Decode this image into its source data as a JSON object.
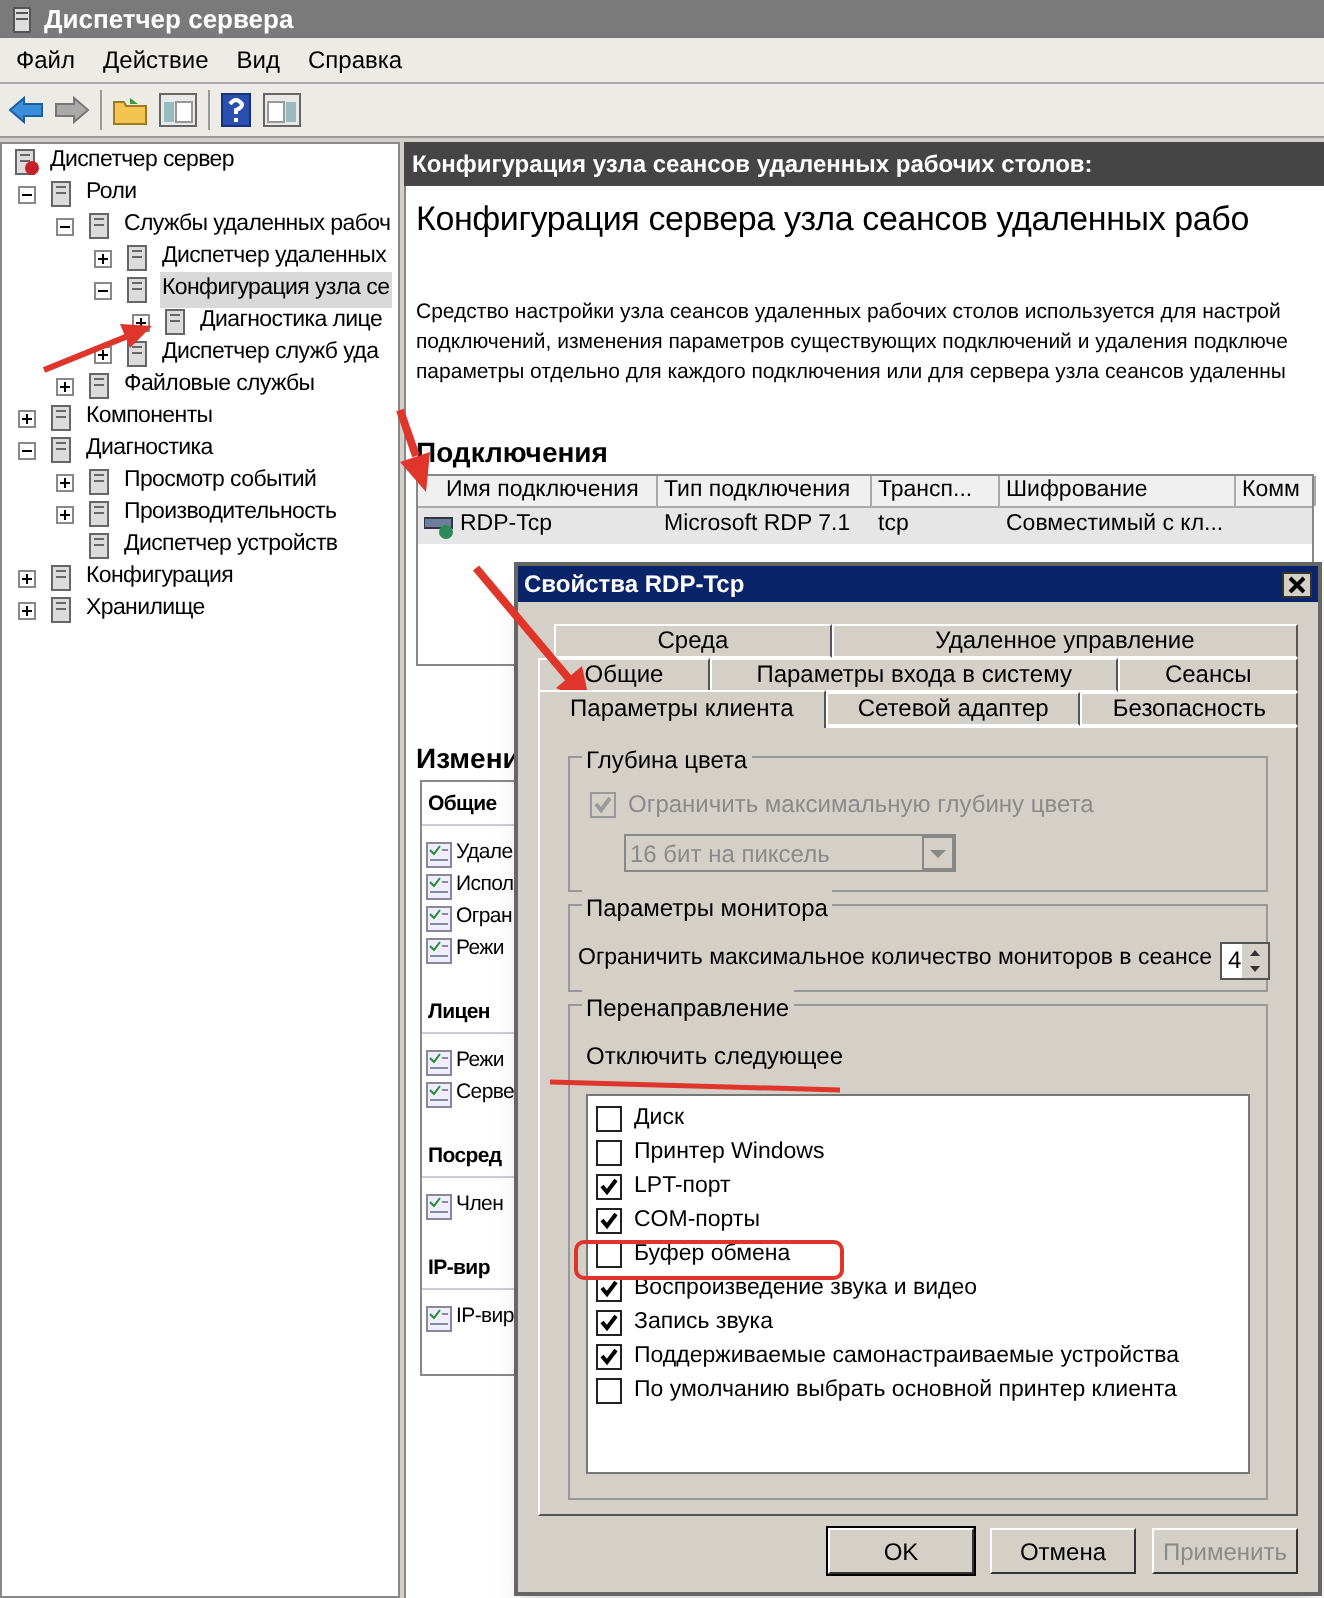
{
  "window": {
    "title": "Диспетчер сервера"
  },
  "menu": [
    "Файл",
    "Действие",
    "Вид",
    "Справка"
  ],
  "tree": [
    {
      "label": "Диспетчер сервер",
      "kind": "root",
      "selected": false,
      "children": [
        {
          "label": "Роли",
          "kind": "node",
          "expanded": true,
          "selected": false,
          "children": [
            {
              "label": "Службы удаленных рабоч",
              "kind": "node",
              "expanded": true,
              "selected": false,
              "children": [
                {
                  "label": "Диспетчер удаленных",
                  "kind": "node",
                  "expanded": false,
                  "selected": false
                },
                {
                  "label": "Конфигурация узла се",
                  "kind": "node",
                  "expanded": true,
                  "selected": true,
                  "children": [
                    {
                      "label": "Диагностика лице",
                      "kind": "node",
                      "expanded": false,
                      "selected": false
                    }
                  ]
                },
                {
                  "label": "Диспетчер служб уда",
                  "kind": "node",
                  "expanded": false,
                  "selected": false
                }
              ]
            },
            {
              "label": "Файловые службы",
              "kind": "node",
              "expanded": false,
              "selected": false
            }
          ]
        },
        {
          "label": "Компоненты",
          "kind": "node",
          "expanded": false,
          "selected": false
        },
        {
          "label": "Диагностика",
          "kind": "node",
          "expanded": true,
          "selected": false,
          "children": [
            {
              "label": "Просмотр событий",
              "kind": "node",
              "expanded": false,
              "selected": false
            },
            {
              "label": "Производительность",
              "kind": "node",
              "expanded": false,
              "selected": false
            },
            {
              "label": "Диспетчер устройств",
              "kind": "leaf",
              "selected": false
            }
          ]
        },
        {
          "label": "Конфигурация",
          "kind": "node",
          "expanded": false,
          "selected": false
        },
        {
          "label": "Хранилище",
          "kind": "node",
          "expanded": false,
          "selected": false
        }
      ]
    }
  ],
  "panel": {
    "header": "Конфигурация узла сеансов удаленных рабочих столов:",
    "title": "Конфигурация сервера узла сеансов удаленных рабо",
    "description": [
      "Средство настройки узла сеансов удаленных рабочих столов используется для настрой",
      "подключений, изменения параметров существующих подключений и удаления подключе",
      "параметры отдельно для каждого подключения или для сервера узла сеансов удаленны"
    ],
    "connections": {
      "heading": "Подключения",
      "columns": [
        "Имя подключения",
        "Тип подключения",
        "Трансп...",
        "Шифрование",
        "Комм"
      ],
      "rows": [
        [
          "RDP-Tcp",
          "Microsoft RDP 7.1",
          "tcp",
          "Совместимый с кл..."
        ]
      ]
    },
    "changes": {
      "heading": "Измени",
      "groups": [
        {
          "heading": "Общие",
          "items": [
            "Удале",
            "Испол",
            "Огран",
            "Режи"
          ]
        },
        {
          "heading": "Лицен",
          "items": [
            "Режи",
            "Серве"
          ]
        },
        {
          "heading": "Посред",
          "items": [
            "Член"
          ]
        },
        {
          "heading": "IP-вир",
          "items": [
            "IP-вир"
          ]
        }
      ]
    }
  },
  "dialog": {
    "title": "Свойства RDP-Tcp",
    "tab_rows": [
      [
        {
          "label": "Среда",
          "selected": false
        },
        {
          "label": "Удаленное управление",
          "selected": false
        }
      ],
      [
        {
          "label": "Общие",
          "selected": false
        },
        {
          "label": "Параметры входа в систему",
          "selected": false
        },
        {
          "label": "Сеансы",
          "selected": false
        }
      ],
      [
        {
          "label": "Параметры клиента",
          "selected": true
        },
        {
          "label": "Сетевой адаптер",
          "selected": false
        },
        {
          "label": "Безопасность",
          "selected": false
        }
      ]
    ],
    "color_depth": {
      "legend": "Глубина цвета",
      "checkbox": {
        "label": "Ограничить максимальную глубину цвета",
        "checked": true,
        "disabled": true
      },
      "select": {
        "value": "16 бит на пиксель",
        "disabled": true
      }
    },
    "monitors": {
      "legend": "Параметры монитора",
      "label": "Ограничить максимальное количество мониторов в сеансе",
      "value": "4"
    },
    "redirection": {
      "legend": "Перенаправление",
      "caption": "Отключить следующее",
      "items": [
        {
          "label": "Диск",
          "checked": false
        },
        {
          "label": "Принтер Windows",
          "checked": false
        },
        {
          "label": "LPT-порт",
          "checked": true
        },
        {
          "label": "COM-порты",
          "checked": true
        },
        {
          "label": "Буфер обмена",
          "checked": false
        },
        {
          "label": "Воспроизведение звука и видео",
          "checked": true
        },
        {
          "label": "Запись звука",
          "checked": true
        },
        {
          "label": "Поддерживаемые самонастраиваемые устройства",
          "checked": true
        },
        {
          "label": "По умолчанию выбрать основной принтер клиента",
          "checked": false
        }
      ]
    },
    "buttons": [
      {
        "label": "OK",
        "disabled": false
      },
      {
        "label": "Отмена",
        "disabled": false
      },
      {
        "label": "Применить",
        "disabled": true
      }
    ]
  }
}
